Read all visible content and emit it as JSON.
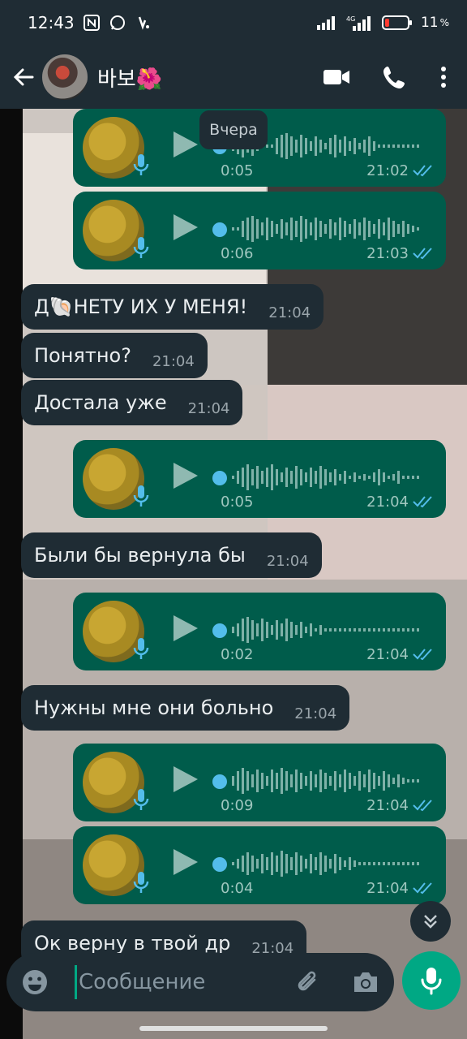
{
  "status_bar": {
    "time": "12:43",
    "battery": "11"
  },
  "header": {
    "contact_name": "바보🌺"
  },
  "date_chip": "Вчера",
  "messages": {
    "voice": [
      {
        "duration": "0:05",
        "time": "21:02"
      },
      {
        "duration": "0:06",
        "time": "21:03"
      },
      {
        "duration": "0:05",
        "time": "21:04"
      },
      {
        "duration": "0:02",
        "time": "21:04"
      },
      {
        "duration": "0:09",
        "time": "21:04"
      },
      {
        "duration": "0:04",
        "time": "21:04"
      }
    ],
    "text": [
      {
        "text": "Д🐚НЕТУ ИХ У МЕНЯ!",
        "time": "21:04"
      },
      {
        "text": "Понятно?",
        "time": "21:04"
      },
      {
        "text": "Достала уже",
        "time": "21:04"
      },
      {
        "text": "Были бы вернула бы",
        "time": "21:04"
      },
      {
        "text": "Нужны мне они больно",
        "time": "21:04"
      },
      {
        "text": "Ок верну в твой др",
        "time": "21:04"
      }
    ]
  },
  "input": {
    "placeholder": "Сообщение"
  },
  "colors": {
    "outgoing": "#005c4b",
    "incoming": "#1f2c34",
    "accent": "#00a884",
    "tick": "#53bdeb"
  }
}
